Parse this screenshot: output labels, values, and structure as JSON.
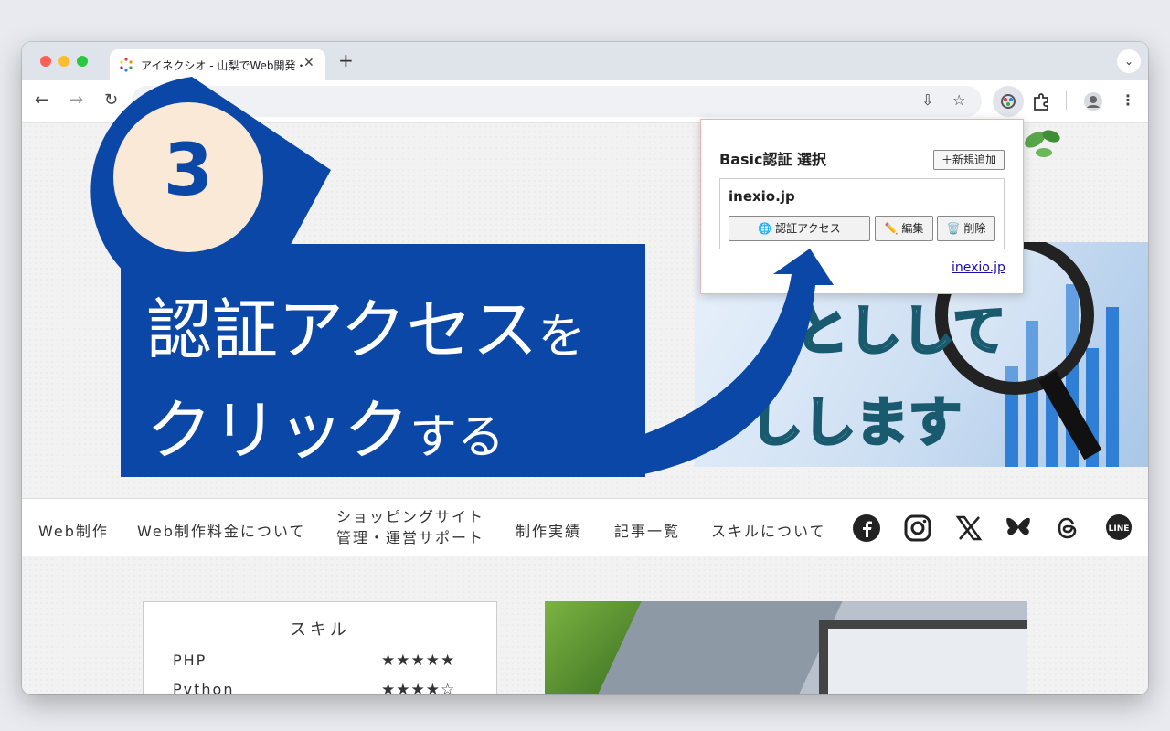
{
  "browser": {
    "tab_title": "アイネクシオ - 山梨でWeb開発・",
    "tab_close": "✕",
    "new_tab": "+",
    "tab_menu": "⌄"
  },
  "hero": {
    "text_line1": "としして",
    "text_line2": "しします",
    "accent_color": "#1a5a6e"
  },
  "global_nav": {
    "items": [
      {
        "label": "Web制作"
      },
      {
        "label": "Web制作料金について"
      },
      {
        "label_line1": "ショッピングサイト",
        "label_line2": "管理・運営サポート"
      },
      {
        "label": "制作実績"
      },
      {
        "label": "記事一覧"
      },
      {
        "label": "スキルについて"
      }
    ],
    "social_icons": [
      "facebook-icon",
      "instagram-icon",
      "x-icon",
      "bluesky-icon",
      "threads-icon",
      "line-icon"
    ]
  },
  "skills": {
    "title": "スキル",
    "items": [
      {
        "name": "PHP",
        "stars": "★★★★★"
      },
      {
        "name": "Python",
        "stars": "★★★★☆"
      }
    ]
  },
  "popup": {
    "title": "Basic認証 選択",
    "add_button": "＋新規追加",
    "entry_host": "inexio.jp",
    "access_button": "🌐 認証アクセス",
    "edit_button": "✏️ 編集",
    "delete_button": "🗑️ 削除",
    "link": "inexio.jp",
    "border_color": "#e6b7b7"
  },
  "overlay": {
    "step_number": "3",
    "line1_main": "認証アクセス",
    "line1_small": "を",
    "line2_main": "クリック",
    "line2_small": "する",
    "brand_color": "#0a47a6",
    "circle_color": "#f9e9d6"
  }
}
